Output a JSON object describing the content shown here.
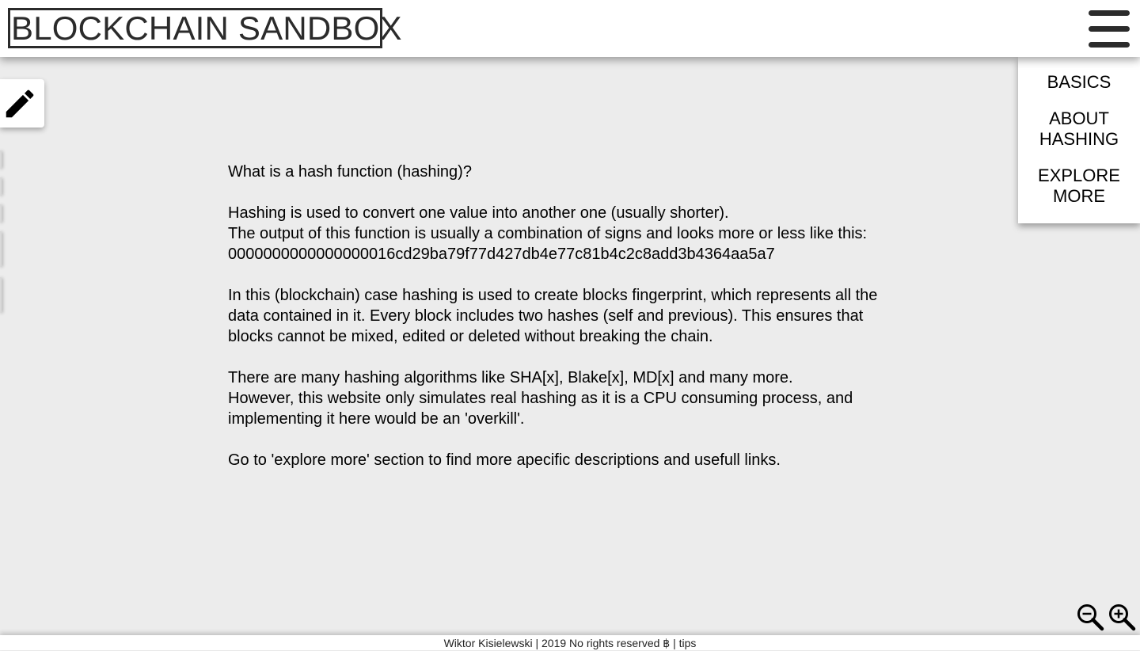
{
  "header": {
    "title": "BLOCKCHAIN SANDBOX",
    "menu_icon": "hamburger-menu-icon"
  },
  "nav": {
    "items": [
      {
        "label": "BASICS"
      },
      {
        "label": "ABOUT HASHING"
      },
      {
        "label": "EXPLORE MORE"
      }
    ]
  },
  "tools": {
    "edit_icon": "pencil-icon",
    "zoom_out_icon": "zoom-out-icon",
    "zoom_in_icon": "zoom-in-icon"
  },
  "content": {
    "heading": "What is a hash function (hashing)?",
    "p1_line1": "Hashing is used to convert one value into another one (usually shorter).",
    "p1_line2": "The output of this function is usually a combination of signs and looks more or less like this:",
    "p1_hash": "0000000000000000016cd29ba79f77d427db4e77c81b4c2c8add3b4364aa5a7",
    "p2": "In this (blockchain) case hashing is used to create blocks fingerprint, which represents all the data contained in it. Every block includes two hashes (self and previous). This ensures that blocks cannot be mixed, edited or deleted without breaking the chain.",
    "p3_line1": "There are many hashing algorithms like SHA[x], Blake[x], MD[x] and many more.",
    "p3_line2": "However, this website only simulates real hashing as it is a CPU consuming process, and implementing it here would be an 'overkill'.",
    "p4": "Go to 'explore more' section to find more apecific descriptions and usefull links."
  },
  "footer": {
    "credit": "Wiktor Kisielewski | 2019 No rights reserved ฿ | ",
    "tips_label": "tips"
  },
  "colors": {
    "page_background": "#ececec",
    "surface": "#ffffff",
    "ink": "#2b2b2b"
  }
}
